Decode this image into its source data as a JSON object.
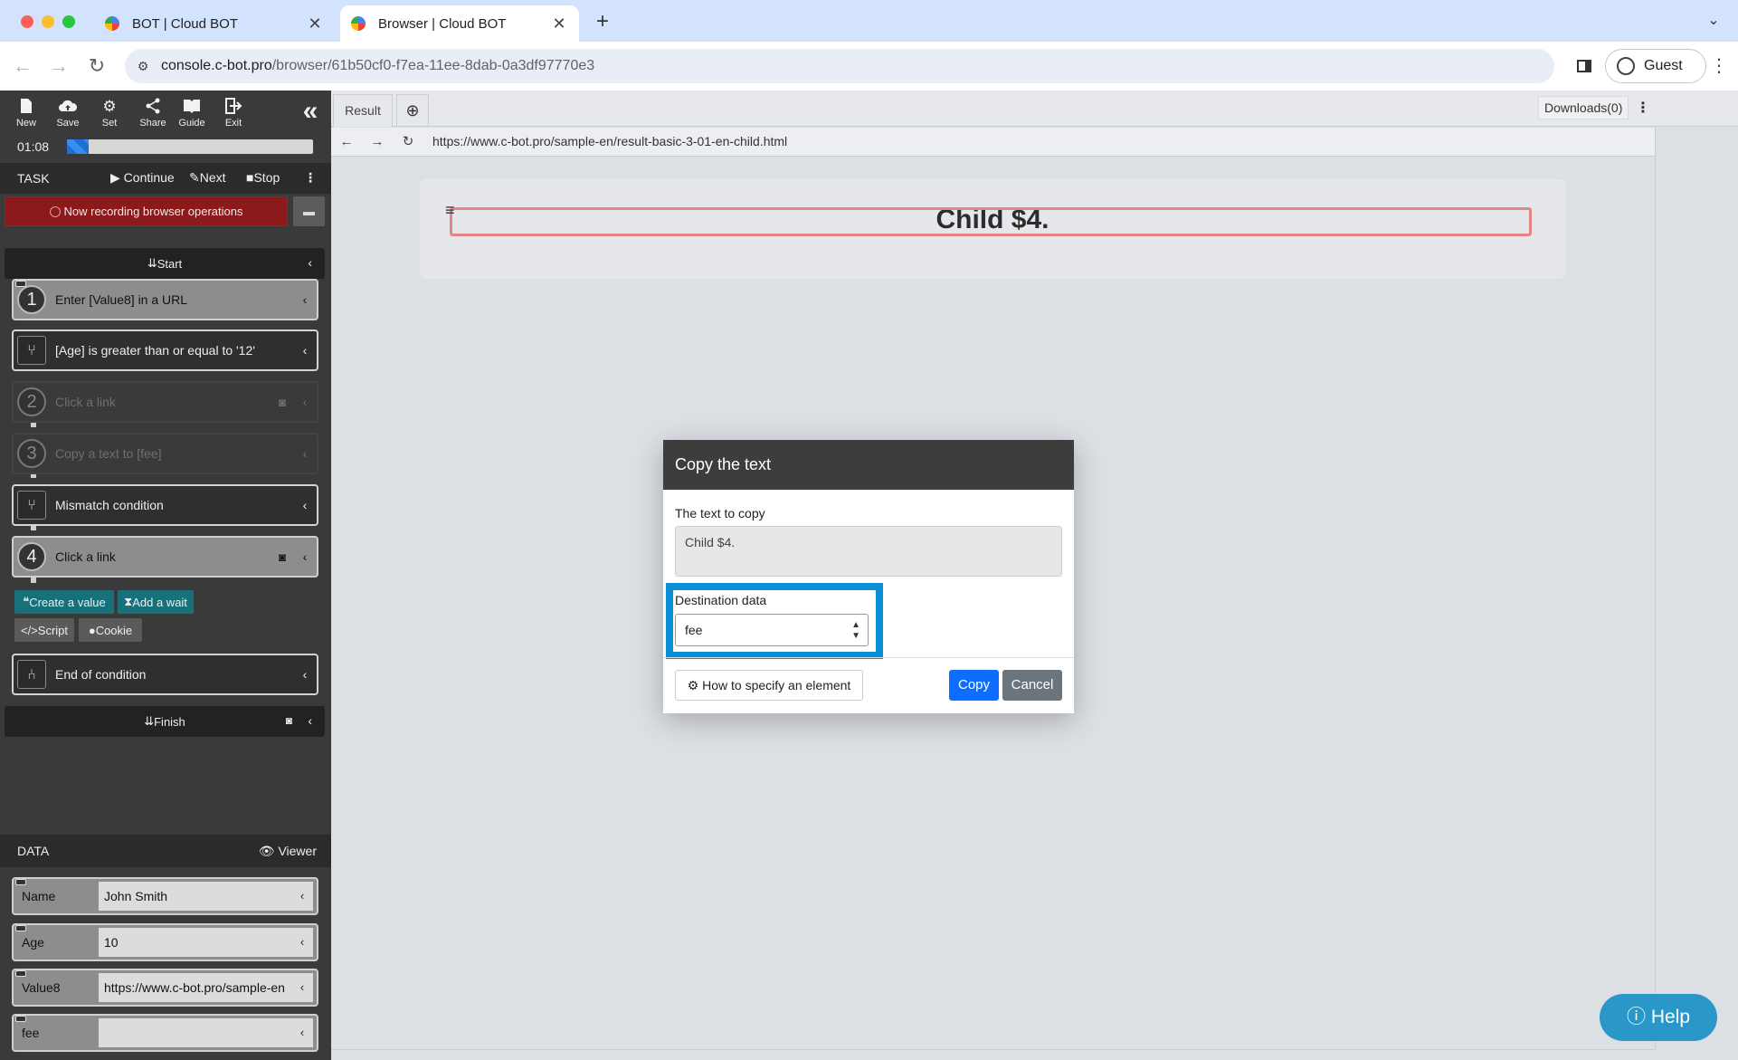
{
  "browser": {
    "tabs": [
      {
        "label": "BOT | Cloud BOT",
        "active": false
      },
      {
        "label": "Browser | Cloud BOT",
        "active": true
      }
    ],
    "url_host": "console.c-bot.pro",
    "url_path": "/browser/61b50cf0-f7ea-11ee-8dab-0a3df97770e3",
    "profile_label": "Guest",
    "traffic_colors": {
      "close": "#ff5f57",
      "minimize": "#febc2e",
      "maximize": "#28c840"
    }
  },
  "left_panel": {
    "toolbar": [
      {
        "label": "New",
        "icon": "file-icon",
        "glyph": "🗋"
      },
      {
        "label": "Save",
        "icon": "cloud-upload-icon",
        "glyph": "☁"
      },
      {
        "label": "Set",
        "icon": "gear-icon",
        "glyph": "⚙"
      },
      {
        "label": "Share",
        "icon": "share-icon",
        "glyph": "⟨"
      },
      {
        "label": "Guide",
        "icon": "book-icon",
        "glyph": "📖"
      },
      {
        "label": "Exit",
        "icon": "exit-icon",
        "glyph": "⇥"
      }
    ],
    "timer": "01:08",
    "progress_fraction": 0.09,
    "task": {
      "title": "TASK",
      "continue_label": "Continue",
      "next_label": "Next",
      "stop_label": "Stop"
    },
    "recording_label": "Now recording browser operations",
    "start_label": "Start",
    "steps": [
      {
        "num": "1",
        "label": "Enter [Value8] in a URL",
        "style": "light"
      },
      {
        "label": "[Age] is greater than or equal to '12'",
        "style": "dark",
        "icon": "branch-icon"
      },
      {
        "num": "2",
        "label": "Click a link",
        "style": "disabled",
        "camera": true
      },
      {
        "num": "3",
        "label": "Copy a text to [fee]",
        "style": "disabled"
      },
      {
        "label": "Mismatch condition",
        "style": "dark",
        "icon": "branch-icon"
      },
      {
        "num": "4",
        "label": "Click a link",
        "style": "light",
        "camera": true
      },
      {
        "label": "End of condition",
        "style": "dark",
        "icon": "branch-end-icon"
      }
    ],
    "action_buttons": {
      "create_value": "Create a value",
      "add_wait": "Add a wait",
      "script": "Script",
      "cookie": "Cookie"
    },
    "finish_label": "Finish",
    "data": {
      "title": "DATA",
      "viewer_label": "Viewer",
      "rows": [
        {
          "name": "Name",
          "value": "John Smith"
        },
        {
          "name": "Age",
          "value": "10"
        },
        {
          "name": "Value8",
          "value": "https://www.c-bot.pro/sample-en"
        },
        {
          "name": "fee",
          "value": ""
        }
      ]
    }
  },
  "content": {
    "tab_result": "Result",
    "downloads_label": "Downloads(0)",
    "inner_url": "https://www.c-bot.pro/sample-en/result-basic-3-01-en-child.html",
    "page_heading": "Child $4."
  },
  "dialog": {
    "title": "Copy the text",
    "text_label": "The text to copy",
    "text_value": "Child $4.",
    "dest_label": "Destination data",
    "dest_value": "fee",
    "howto_label": "How to specify an element",
    "copy_label": "Copy",
    "cancel_label": "Cancel"
  },
  "help_label": "Help"
}
